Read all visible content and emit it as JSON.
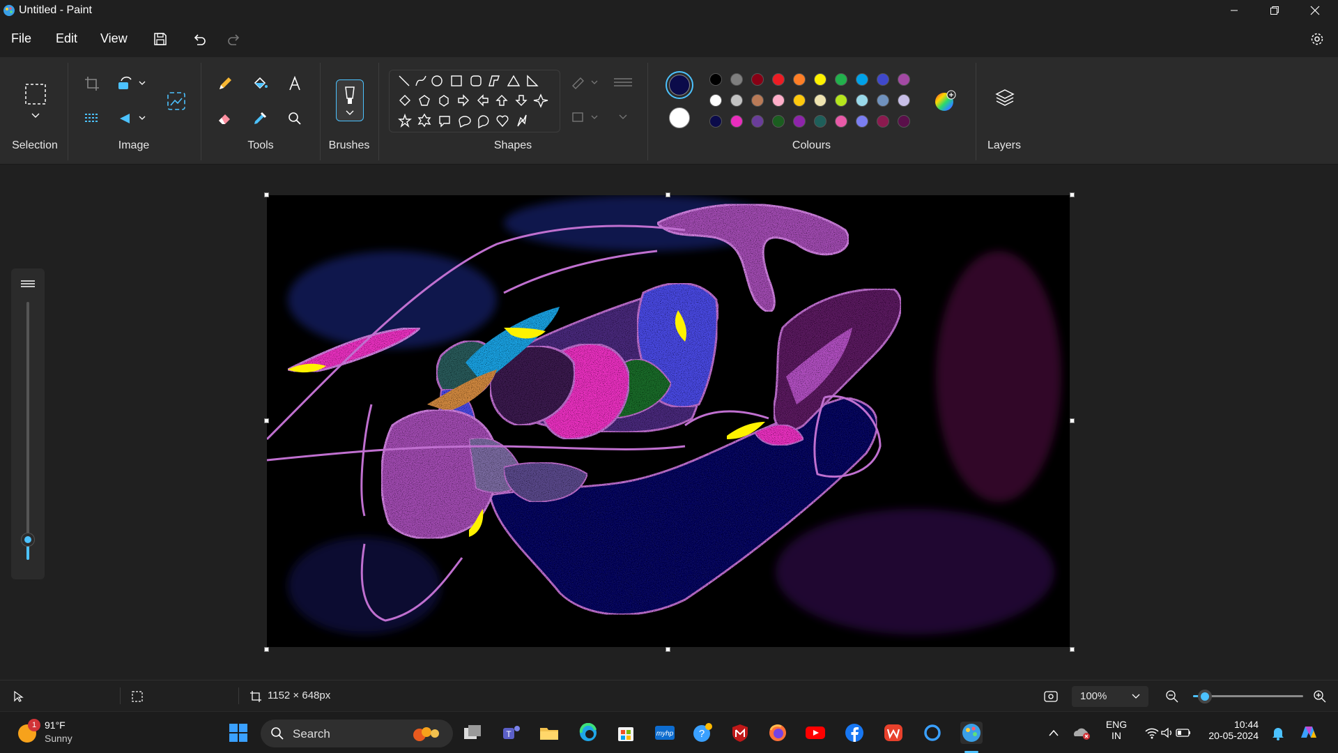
{
  "window": {
    "title": "Untitled - Paint"
  },
  "menu": {
    "file": "File",
    "edit": "Edit",
    "view": "View"
  },
  "ribbon": {
    "groups": {
      "selection": "Selection",
      "image": "Image",
      "tools": "Tools",
      "brushes": "Brushes",
      "shapes": "Shapes",
      "colours": "Colours",
      "layers": "Layers"
    },
    "primary_colour": "#0b0b4a",
    "secondary_colour": "#ffffff",
    "palette_row1": [
      "#000000",
      "#7f7f7f",
      "#880015",
      "#ed1c24",
      "#ff7f27",
      "#fff200",
      "#22b14c",
      "#00a2e8",
      "#3f48cc",
      "#a349a4"
    ],
    "palette_row2": [
      "#ffffff",
      "#c3c3c3",
      "#b97a57",
      "#ffaec9",
      "#ffc90e",
      "#efe4b0",
      "#b5e61d",
      "#99d9ea",
      "#7092be",
      "#c8bfe7"
    ],
    "palette_row3": [
      "#0b0b4a",
      "#e92dbd",
      "#6a3d9a",
      "#1b5e20",
      "#8e24aa",
      "#1e5f5a",
      "#e85aa8",
      "#7b7ff2",
      "#8b1a4f",
      "#5a0f4a"
    ]
  },
  "status": {
    "canvas_size": "1152 × 648px",
    "zoom": "100%"
  },
  "taskbar": {
    "weather_temp": "91°F",
    "weather_desc": "Sunny",
    "weather_badge": "1",
    "search_label": "Search",
    "lang_line1": "ENG",
    "lang_line2": "IN",
    "time": "10:44",
    "date": "20-05-2024"
  },
  "colors": {
    "accent": "#4cc2ff"
  }
}
